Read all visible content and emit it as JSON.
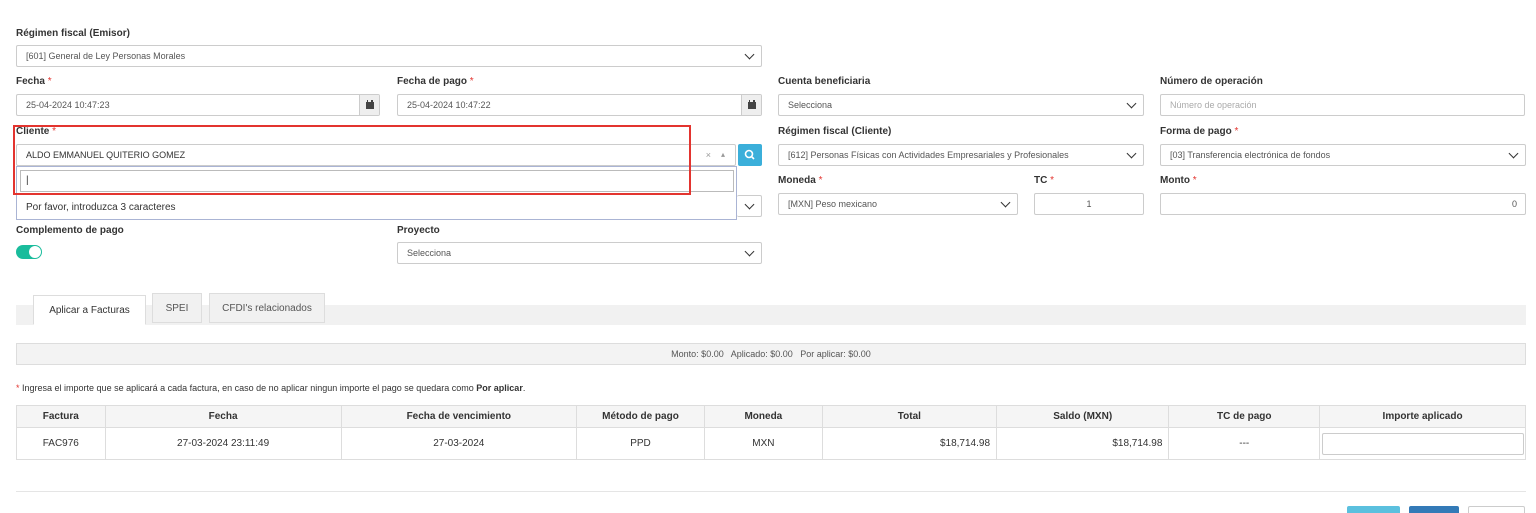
{
  "regimen_emisor": {
    "label": "Régimen fiscal (Emisor)",
    "value": "[601] General de Ley Personas Morales"
  },
  "fecha": {
    "label": "Fecha",
    "value": "25-04-2024 10:47:23"
  },
  "fecha_pago": {
    "label": "Fecha de pago",
    "value": "25-04-2024 10:47:22"
  },
  "cuenta_beneficiaria": {
    "label": "Cuenta beneficiaria",
    "value": "Selecciona"
  },
  "numero_operacion": {
    "label": "Número de operación",
    "placeholder": "Número de operación"
  },
  "cliente": {
    "label": "Cliente",
    "value": "ALDO EMMANUEL QUITERIO GOMEZ",
    "clear": "×",
    "arrow": "▴",
    "search_value": "|",
    "hint": "Por favor, introduzca 3 caracteres"
  },
  "regimen_cliente": {
    "label": "Régimen fiscal (Cliente)",
    "value": "[612] Personas Físicas con Actividades Empresariales y Profesionales"
  },
  "forma_pago": {
    "label": "Forma de pago",
    "value": "[03] Transferencia electrónica de fondos"
  },
  "moneda": {
    "label": "Moneda",
    "value": "[MXN] Peso mexicano"
  },
  "tc": {
    "label": "TC",
    "value": "1"
  },
  "monto": {
    "label": "Monto",
    "value": "0"
  },
  "complemento": {
    "label": "Complemento de pago",
    "enabled": true
  },
  "proyecto": {
    "label": "Proyecto",
    "value": "Selecciona"
  },
  "tabs": [
    {
      "label": "Aplicar a Facturas",
      "active": true
    },
    {
      "label": "SPEI",
      "active": false
    },
    {
      "label": "CFDI's relacionados",
      "active": false
    }
  ],
  "summary": "Monto: $0.00   Aplicado: $0.00   Por aplicar: $0.00",
  "note": {
    "asterisk": "*",
    "text": " Ingresa el importe que se aplicará a cada factura, en caso de no aplicar ningun importe el pago se quedara como ",
    "bold": "Por aplicar",
    "end": "."
  },
  "table": {
    "headers": [
      "Factura",
      "Fecha",
      "Fecha de vencimiento",
      "Método de pago",
      "Moneda",
      "Total",
      "Saldo (MXN)",
      "TC de pago",
      "Importe aplicado"
    ],
    "rows": [
      [
        "FAC976",
        "27-03-2024 23:11:49",
        "27-03-2024",
        "PPD",
        "MXN",
        "$18,714.98",
        "$18,714.98",
        "---",
        ""
      ]
    ]
  },
  "colors": {
    "accent": "#1abc9c",
    "highlight": "#e3342f",
    "search_btn": "#3bafda",
    "btn_primary": "#337ab7"
  }
}
